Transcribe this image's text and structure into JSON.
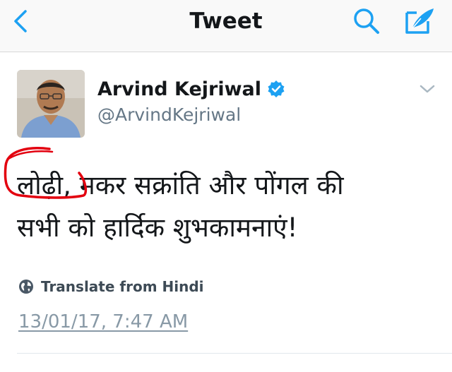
{
  "nav": {
    "title": "Tweet",
    "back_icon": "chevron-left-icon",
    "search_icon": "search-icon",
    "compose_icon": "compose-icon",
    "accent": "#1da1f2"
  },
  "tweet": {
    "author_name": "Arvind Kejriwal",
    "handle": "@ArvindKejriwal",
    "verified": true,
    "text_line_1_word": "लोढ़ी,",
    "text_line_1_rest": " मकर सक्रांति और पोंगल की",
    "text_line_2": "सभी को हार्दिक शुभकामनाएं!",
    "translate_label": "Translate from Hindi",
    "timestamp": "13/01/17, 7:47 AM"
  },
  "colors": {
    "verified_badge": "#1da1f2",
    "annotation_circle": "#e3000f",
    "secondary_text": "#657786"
  }
}
